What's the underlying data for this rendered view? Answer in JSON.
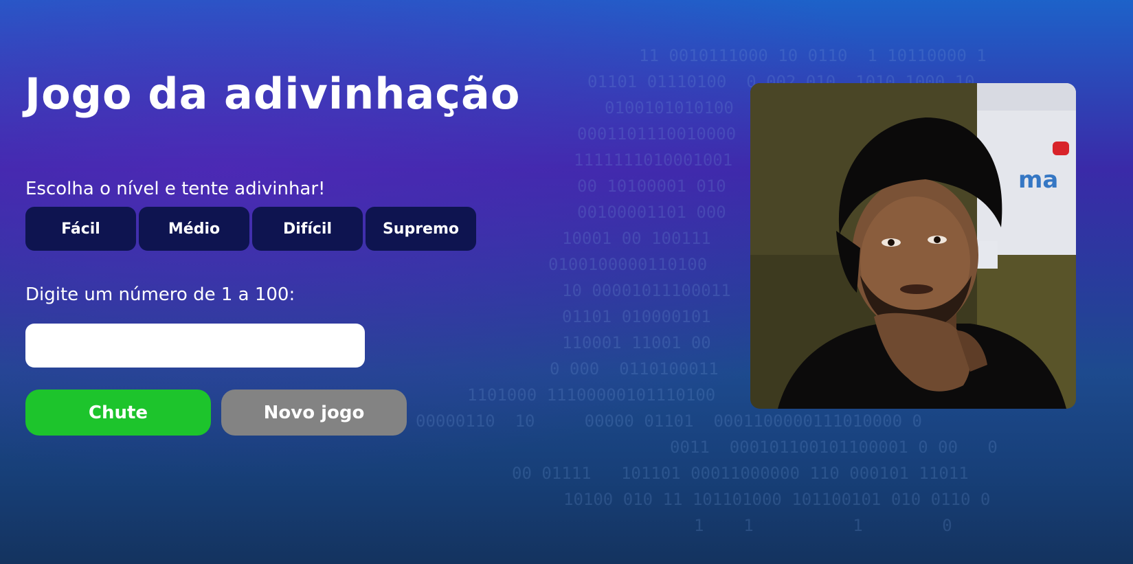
{
  "title": "Jogo da adivinhação",
  "level_prompt": "Escolha o nível e tente adivinhar!",
  "levels": [
    {
      "label": "Fácil"
    },
    {
      "label": "Médio"
    },
    {
      "label": "Difícil"
    },
    {
      "label": "Supremo"
    }
  ],
  "number_prompt": "Digite um número de 1 a 100:",
  "guess_input": {
    "value": "",
    "placeholder": ""
  },
  "buttons": {
    "guess": "Chute",
    "new_game": "Novo jogo"
  },
  "colors": {
    "level_button": "#0e1450",
    "guess_button": "#1dc42c",
    "new_game_button": "#838383"
  },
  "photo": {
    "icon": "person-portrait-photo"
  }
}
